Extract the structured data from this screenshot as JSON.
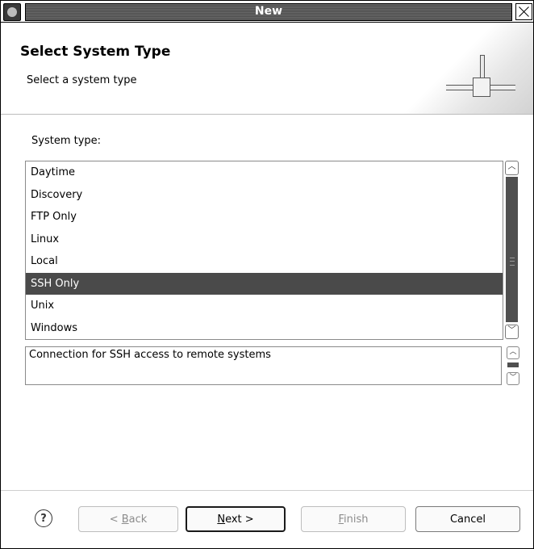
{
  "window": {
    "title": "New"
  },
  "header": {
    "title": "Select System Type",
    "subtitle": "Select a system type"
  },
  "system_type": {
    "label": "System type:",
    "items": [
      {
        "label": "Daytime"
      },
      {
        "label": "Discovery"
      },
      {
        "label": "FTP Only"
      },
      {
        "label": "Linux"
      },
      {
        "label": "Local"
      },
      {
        "label": "SSH Only"
      },
      {
        "label": "Unix"
      },
      {
        "label": "Windows"
      }
    ],
    "selected": "SSH Only"
  },
  "description": "Connection for SSH access to remote systems",
  "buttons": {
    "help": "?",
    "back": {
      "prefix": "< ",
      "mnemonic": "B",
      "rest": "ack"
    },
    "next": {
      "mnemonic": "N",
      "rest": "ext >"
    },
    "finish": {
      "mnemonic": "F",
      "rest": "inish"
    },
    "cancel": "Cancel"
  },
  "colors": {
    "selection": "#4a4a4a",
    "titlebar": "#5a5a5a"
  },
  "icons": {
    "window": "app-icon",
    "close": "close-icon",
    "header": "connector-plug-icon",
    "help": "help-icon"
  }
}
